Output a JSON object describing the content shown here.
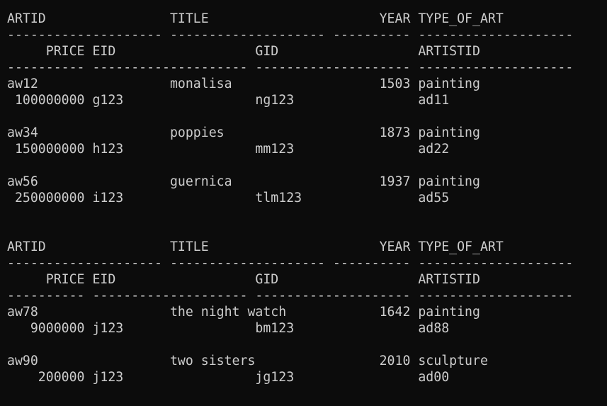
{
  "terminal": {
    "lines": [
      "ARTID                TITLE                      YEAR TYPE_OF_ART",
      "-------------------- -------------------- ---------- --------------------",
      "     PRICE EID                  GID                  ARTISTID",
      "---------- -------------------- -------------------- --------------------",
      "aw12                 monalisa                   1503 painting",
      " 100000000 g123                 ng123                ad11",
      "",
      "aw34                 poppies                    1873 painting",
      " 150000000 h123                 mm123                ad22",
      "",
      "aw56                 guernica                   1937 painting",
      " 250000000 i123                 tlm123               ad55",
      "",
      "",
      "ARTID                TITLE                      YEAR TYPE_OF_ART",
      "-------------------- -------------------- ---------- --------------------",
      "     PRICE EID                  GID                  ARTISTID",
      "---------- -------------------- -------------------- --------------------",
      "aw78                 the night watch            1642 painting",
      "   9000000 j123                 bm123                ad88",
      "",
      "aw90                 two sisters                2010 sculpture",
      "    200000 j123                 jg123                ad00"
    ]
  }
}
